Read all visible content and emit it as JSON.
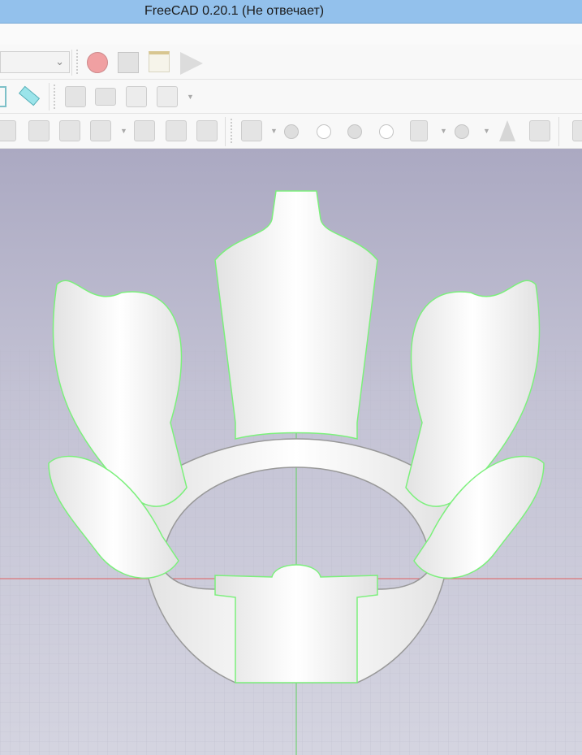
{
  "window": {
    "title": "FreeCAD 0.20.1 (Не отвечает)"
  },
  "toolbar": {
    "workbench_select_value": "",
    "macro": [
      "record-macro",
      "stop-macro",
      "edit-macro",
      "execute-macro"
    ],
    "view_icons": [
      "measure",
      "part",
      "open-folder",
      "share",
      "share-more"
    ],
    "part_icons": [
      "revolve",
      "mirror",
      "loft",
      "extrude",
      "shell",
      "offset",
      "box",
      "compound",
      "union",
      "cut",
      "common",
      "section",
      "join",
      "boolean",
      "cone",
      "refine"
    ]
  },
  "colors": {
    "title_bar": "#93c1ec",
    "edge_highlight": "#7cf07c",
    "axis_x": "#e05050",
    "axis_y": "#60d060"
  }
}
